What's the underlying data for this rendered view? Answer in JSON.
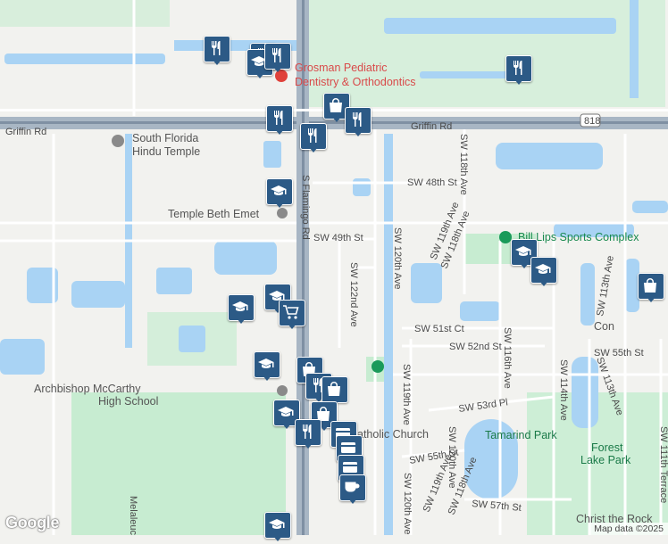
{
  "streets": {
    "griffin_rd_left": "Griffin Rd",
    "griffin_rd_right": "Griffin Rd",
    "route_shield": "818",
    "flamingo_rd": "S Flamingo Rd",
    "sw_48th_st": "SW 48th St",
    "sw_49th_st": "SW 49th St",
    "sw_122nd_ave": "SW 122nd Ave",
    "sw_120th_ave_north": "SW 120th Ave",
    "sw_120th_ave_south": "SW 120th Ave",
    "sw_118th_ave": "SW 118th Ave",
    "sw_118th_ave_2": "SW 118th Ave",
    "sw_119th_ave": "SW 119th Ave",
    "sw_119th_ave_2": "SW 119th Ave",
    "sw_119th_ave_3": "SW 119th Ave",
    "sw_116th_ave": "SW 116th Ave",
    "sw_113th_ave": "SW 113th Ave",
    "sw_113th_ave_2": "SW 113th Ave",
    "sw_114th_ave": "SW 114th Ave",
    "sw_118th_ave_3": "SW 118th Ave",
    "sw_51st_ct": "SW 51st Ct",
    "sw_52nd_st": "SW 52nd St",
    "sw_55th_st": "SW 55th St",
    "sw_55th_st_2": "SW 55th St",
    "sw_53rd_pl": "SW 53rd Pl",
    "sw_57th_st": "SW 57th St",
    "sw_111th_terrace": "SW 111th Terrace",
    "melaleuca": "Melaleuc"
  },
  "places": {
    "grosman_line1": "Grosman Pediatric",
    "grosman_line2": "Dentistry & Orthodontics",
    "hindu_line1": "South Florida",
    "hindu_line2": "Hindu Temple",
    "temple_beth_emet": "Temple Beth Emet",
    "bill_lips": "Bill Lips Sports Complex",
    "archbishop_line1": "Archbishop McCarthy",
    "archbishop_line2": "High School",
    "catholic_church": "atholic Church",
    "tamarind_park": "Tamarind Park",
    "forest_line1": "Forest",
    "forest_line2": "Lake Park",
    "christ_the_rock": "Christ the Rock",
    "con": "Con"
  },
  "markers": [
    {
      "icon": "restaurant-icon"
    },
    {
      "icon": "restaurant-icon"
    },
    {
      "icon": "school-icon"
    },
    {
      "icon": "restaurant-icon"
    },
    {
      "icon": "restaurant-icon"
    },
    {
      "icon": "restaurant-icon"
    },
    {
      "icon": "shopping-bag-icon"
    },
    {
      "icon": "restaurant-icon"
    },
    {
      "icon": "restaurant-icon"
    },
    {
      "icon": "school-icon"
    },
    {
      "icon": "school-icon"
    },
    {
      "icon": "school-icon"
    },
    {
      "icon": "shopping-bag-icon"
    },
    {
      "icon": "school-icon"
    },
    {
      "icon": "school-icon"
    },
    {
      "icon": "shopping-cart-icon"
    },
    {
      "icon": "school-icon"
    },
    {
      "icon": "shopping-bag-icon"
    },
    {
      "icon": "restaurant-icon"
    },
    {
      "icon": "shopping-bag-icon"
    },
    {
      "icon": "school-icon"
    },
    {
      "icon": "shopping-bag-icon"
    },
    {
      "icon": "restaurant-icon"
    },
    {
      "icon": "atm-icon"
    },
    {
      "icon": "atm-icon"
    },
    {
      "icon": "atm-icon"
    },
    {
      "icon": "coffee-icon"
    },
    {
      "icon": "school-icon"
    }
  ],
  "attribution": {
    "logo": "Google",
    "text": "Map data ©2025"
  },
  "colors": {
    "water": "#a9d3f4",
    "park": "#c7ecd1",
    "main_road": "#a8b6c4",
    "marker": "#2c5a86",
    "hospital_red": "#e0413a",
    "park_green": "#1a9a5a"
  }
}
